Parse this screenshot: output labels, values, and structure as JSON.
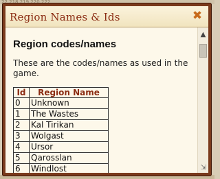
{
  "background": {
    "ruler_text": "22    218    219    220    222"
  },
  "dialog": {
    "title": "Region Names & Ids",
    "close_glyph": "✖",
    "heading": "Region codes/names",
    "intro": "These are the codes/names as used in the game.",
    "table": {
      "headers": [
        "Id",
        "Region Name"
      ],
      "rows": [
        {
          "id": "0",
          "name": "Unknown"
        },
        {
          "id": "1",
          "name": "The Wastes"
        },
        {
          "id": "2",
          "name": "Kal Tirikan"
        },
        {
          "id": "3",
          "name": "Wolgast"
        },
        {
          "id": "4",
          "name": "Ursor"
        },
        {
          "id": "5",
          "name": "Qarosslan"
        },
        {
          "id": "6",
          "name": "Windlost"
        }
      ]
    },
    "scrollbar": {
      "up_glyph": "▲",
      "resize_glyph": "⇲"
    }
  },
  "colors": {
    "frame": "#7a3a1c",
    "title_text": "#8b2c13",
    "close": "#c76a1a",
    "content_bg": "#fdf8ea"
  }
}
